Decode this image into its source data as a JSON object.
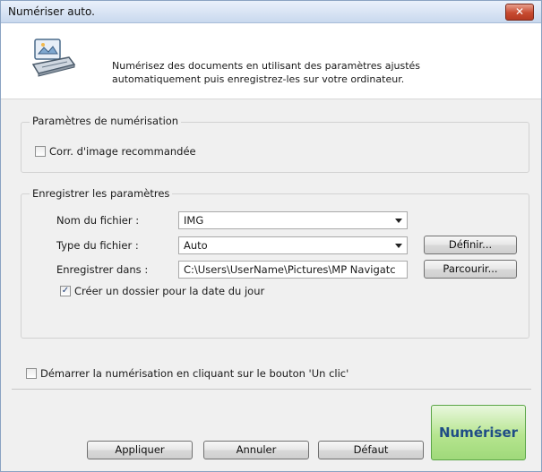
{
  "window": {
    "title": "Numériser auto.",
    "close_label": "✕"
  },
  "header": {
    "description_line1": "Numérisez des documents en utilisant des paramètres ajustés",
    "description_line2": "automatiquement puis enregistrez-les sur votre ordinateur."
  },
  "scan_settings": {
    "group_label": "Paramètres de numérisation",
    "image_correction": {
      "label": "Corr. d'image recommandée",
      "checked": false
    }
  },
  "save_settings": {
    "group_label": "Enregistrer les paramètres",
    "file_name": {
      "label": "Nom du fichier :",
      "value": "IMG"
    },
    "file_type": {
      "label": "Type du fichier :",
      "value": "Auto",
      "define_button": "Définir..."
    },
    "save_in": {
      "label": "Enregistrer dans :",
      "value": "C:\\Users\\UserName\\Pictures\\MP Navigatc",
      "browse_button": "Parcourir..."
    },
    "create_folder": {
      "label": "Créer un dossier pour la date du jour",
      "checked": true
    }
  },
  "one_click": {
    "label": "Démarrer la numérisation en cliquant sur le bouton 'Un clic'",
    "checked": false
  },
  "footer": {
    "apply": "Appliquer",
    "cancel": "Annuler",
    "default": "Défaut",
    "scan": "Numériser"
  },
  "colors": {
    "scan_button": "#a8df84",
    "scan_text": "#1f4d86",
    "close_button": "#c74a30"
  }
}
